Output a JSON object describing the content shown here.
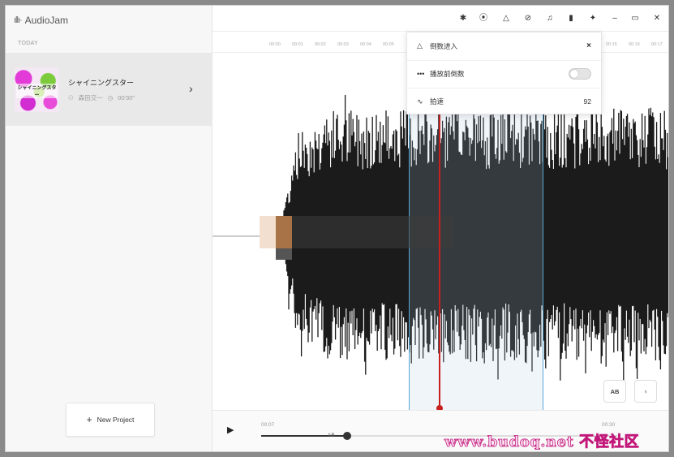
{
  "app": {
    "name": "AudioJam"
  },
  "sidebar": {
    "section_label": "TODAY",
    "project": {
      "title": "シャイニングスター",
      "artist": "森田交一",
      "duration": "00'30\"",
      "cover_text": "シャイニングスター"
    },
    "new_project_label": "New Project"
  },
  "toolbar": {
    "icons": [
      "gear-icon",
      "broadcast-icon",
      "metronome-icon",
      "paperclip-icon",
      "music-note-icon",
      "bookmark-icon",
      "pin-icon",
      "minimize-icon",
      "maximize-icon",
      "close-icon"
    ]
  },
  "ruler": {
    "ticks_left": [
      "00:00",
      "00:01",
      "00:02",
      "00:03",
      "00:04",
      "00:05"
    ],
    "ticks_right": [
      "00:15",
      "00:16",
      "00:17"
    ]
  },
  "countdown_panel": {
    "header": "倒数进入",
    "close": "×",
    "rows": [
      {
        "icon": "dots-icon",
        "label": "播放前倒数",
        "type": "toggle",
        "value": false
      },
      {
        "icon": "tempo-icon",
        "label": "拍速",
        "type": "number",
        "value": "92"
      }
    ]
  },
  "wave_buttons": {
    "ab": "AB",
    "marker": "♀"
  },
  "transport": {
    "start_time": "00:07",
    "end_time": "00:30",
    "ab_marker": "AB",
    "progress": 0.24
  },
  "watermark": "www.budoq.net 不怪社区",
  "colors": {
    "playhead": "#c8201f",
    "region": "#5aa7d6",
    "waveform": "#1b1b1b"
  }
}
